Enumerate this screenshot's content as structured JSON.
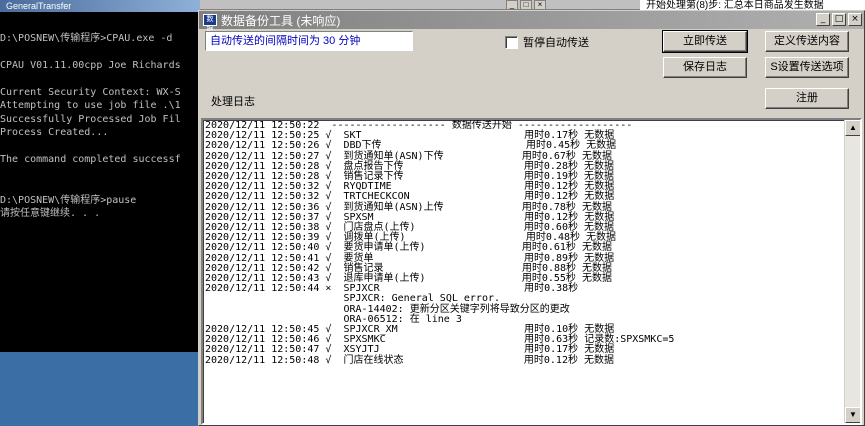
{
  "console": {
    "title": "GeneralTransfer",
    "lines": [
      "",
      "D:\\POSNEW\\传输程序>CPAU.exe -d",
      "",
      "CPAU V01.11.00cpp Joe Richards",
      "",
      "Current Security Context: WX-S",
      "Attempting to use job file .\\1",
      "Successfully Processed Job Fil",
      "Process Created...",
      "",
      "The command completed successf",
      "",
      "",
      "D:\\POSNEW\\传输程序>pause",
      "请按任意键继续. . ."
    ]
  },
  "background_window": {
    "title": "开始处理第(8)步: 汇总本日商品发生数据"
  },
  "main_window": {
    "title": "数据备份工具 (未响应)",
    "icon_label": "数据",
    "interval_text": "自动传送的间隔时间为 30 分钟",
    "pause_label": "暂停自动传送",
    "buttons": {
      "send_now": "立即传送",
      "define_content": "定义传送内容",
      "save_log": "保存日志",
      "set_options": "S设置传送选项",
      "register": "注册"
    },
    "log_label": "处理日志",
    "log_lines": [
      "2020/12/11 12:50:22  ------------------- 数据传送开始 -------------------",
      "2020/12/11 12:50:25 √  SKT                           用时0.17秒 无数据",
      "2020/12/11 12:50:26 √  DBD下传                        用时0.45秒 无数据",
      "2020/12/11 12:50:27 √  到货通知单(ASN)下传             用时0.67秒 无数据",
      "2020/12/11 12:50:28 √  盘点报告下传                    用时0.28秒 无数据",
      "2020/12/11 12:50:28 √  销售记录下传                    用时0.19秒 无数据",
      "2020/12/11 12:50:32 √  RYQDTIME                      用时0.12秒 无数据",
      "2020/12/11 12:50:32 √  TRTCHECKCON                   用时0.12秒 无数据",
      "2020/12/11 12:50:36 √  到货通知单(ASN)上传             用时0.78秒 无数据",
      "2020/12/11 12:50:37 √  SPXSM                         用时0.12秒 无数据",
      "2020/12/11 12:50:38 √  门店盘点(上传)                  用时0.60秒 无数据",
      "2020/12/11 12:50:39 √  调拨单(上传)                    用时0.48秒 无数据",
      "2020/12/11 12:50:40 √  要货申请单(上传)                用时0.61秒 无数据",
      "2020/12/11 12:50:41 √  要货单                         用时0.89秒 无数据",
      "2020/12/11 12:50:42 √  销售记录                       用时0.88秒 无数据",
      "2020/12/11 12:50:43 √  退库申请单(上传)                用时0.55秒 无数据",
      "2020/12/11 12:50:44 ×  SPJXCR                        用时0.38秒",
      "                       SPJXCR: General SQL error.",
      "                       ORA-14402: 更新分区关键字列将导致分区的更改",
      "                       ORA-06512: 在 line 3",
      "2020/12/11 12:50:45 √  SPJXCR_XM                     用时0.10秒 无数据",
      "2020/12/11 12:50:46 √  SPXSMKC                       用时0.63秒 记录数:SPXSMKC=5",
      "2020/12/11 12:50:47 √  XSYJTJ                        用时0.17秒 无数据",
      "2020/12/11 12:50:48 √  门店在线状态                    用时0.12秒 无数据"
    ]
  }
}
